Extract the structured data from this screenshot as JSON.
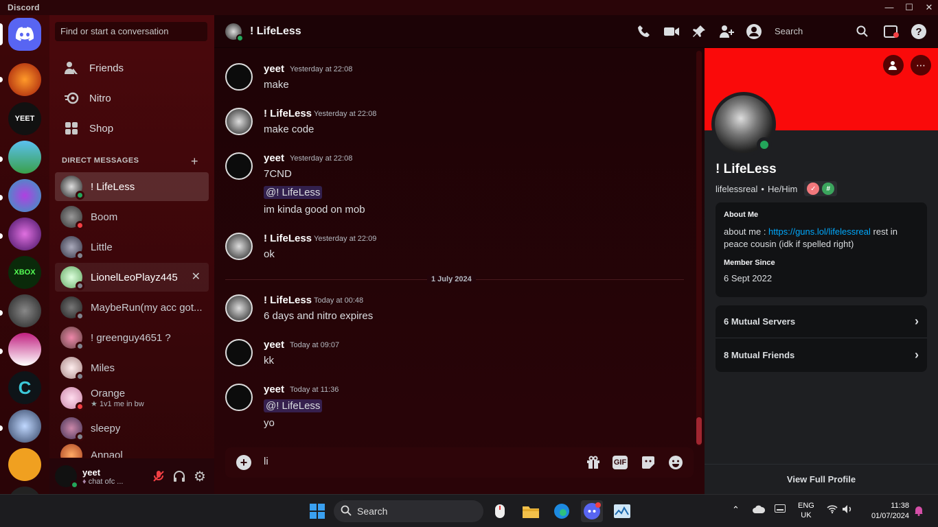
{
  "window": {
    "app_title": "Discord"
  },
  "sidebar": {
    "search_placeholder": "Find or start a conversation",
    "nav": [
      {
        "label": "Friends",
        "icon": "friends-icon"
      },
      {
        "label": "Nitro",
        "icon": "nitro-icon"
      },
      {
        "label": "Shop",
        "icon": "shop-icon"
      }
    ],
    "dm_header": "DIRECT MESSAGES",
    "dms": [
      {
        "name": "! LifeLess",
        "status": "online",
        "active": true
      },
      {
        "name": "Boom",
        "status": "dnd"
      },
      {
        "name": "Little",
        "status": "offline"
      },
      {
        "name": "LionelLeoPlayz445",
        "status": "offline",
        "hover": true
      },
      {
        "name": "MaybeRun(my acc got...",
        "status": "offline"
      },
      {
        "name": "! greenguy4651 ?",
        "status": "offline"
      },
      {
        "name": "Miles",
        "status": "offline"
      },
      {
        "name": "Orange",
        "status": "dnd",
        "sub": "1v1 me in bw"
      },
      {
        "name": "sleepy",
        "status": "offline"
      },
      {
        "name": "Annaol",
        "status": "offline"
      }
    ]
  },
  "user_panel": {
    "name": "yeet",
    "status_text": "chat ofc ..."
  },
  "chat_header": {
    "title": "! LifeLess",
    "search_placeholder": "Search"
  },
  "messages": [
    {
      "author": "yeet",
      "time": "Yesterday at 22:08",
      "lines": [
        "make"
      ]
    },
    {
      "author": "! LifeLess",
      "time": "Yesterday at 22:08",
      "lines": [
        "make code"
      ]
    },
    {
      "author": "yeet",
      "time": "Yesterday at 22:08",
      "lines": [
        "7CND",
        "@! LifeLess",
        "im kinda good on mob"
      ]
    },
    {
      "author": "! LifeLess",
      "time": "Yesterday at 22:09",
      "lines": [
        "ok"
      ]
    },
    {
      "author": "! LifeLess",
      "time": "Today at 00:48",
      "lines": [
        "6 days and nitro expires"
      ]
    },
    {
      "author": "yeet",
      "time": "Today at 09:07",
      "lines": [
        "kk"
      ]
    },
    {
      "author": "yeet",
      "time": "Today at 11:36",
      "lines": [
        "@! LifeLess",
        "yo"
      ]
    }
  ],
  "date_divider": "1 July 2024",
  "composer": {
    "value": "li",
    "gif_label": "GIF"
  },
  "profile": {
    "name": "! LifeLess",
    "username": "lifelessreal",
    "pronouns": "He/Him",
    "separator": "•",
    "about_title": "About Me",
    "about_prefix": "about me : ",
    "about_link": "https://guns.lol/lifelessreal",
    "about_suffix": " rest in peace cousin (idk if spelled right)",
    "member_since_title": "Member Since",
    "member_since": "6 Sept 2022",
    "mutual_servers": "6 Mutual Servers",
    "mutual_friends": "8 Mutual Friends",
    "view_full": "View Full Profile"
  },
  "taskbar": {
    "search": "Search",
    "lang": "ENG",
    "region": "UK",
    "time": "11:38",
    "date": "01/07/2024"
  },
  "colors": {
    "banner": "#fa0a0a",
    "online": "#23a55a",
    "dnd": "#f23f43",
    "link": "#00a8fc"
  }
}
